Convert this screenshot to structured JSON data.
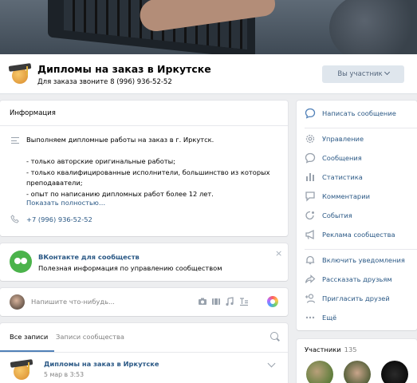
{
  "group": {
    "title": "Дипломы на заказ в Иркутске",
    "subtitle": "Для заказа звоните 8 (996) 936-52-52",
    "member_button": "Вы участник"
  },
  "info": {
    "header": "Информация",
    "description_lines": [
      "Выполняем дипломные работы на заказ в г. Иркутск.",
      "",
      "- только авторские оригинальные работы;",
      "- только квалифицированные исполнители, большинство из которых",
      "преподаватели;",
      "- опыт по написанию дипломных работ более 12 лет."
    ],
    "show_more": "Показать полностью…",
    "phone": "+7 (996) 936-52-52"
  },
  "promo": {
    "title": "ВКонтакте для сообществ",
    "text": "Полезная информация по управлению сообществом",
    "close": "×"
  },
  "composer": {
    "placeholder": "Напишите что-нибудь..."
  },
  "wall": {
    "tab_all": "Все записи",
    "tab_community": "Записи сообщества",
    "post_author": "Дипломы на заказ в Иркутске",
    "post_date": "5 мар в 3:53"
  },
  "menu": {
    "primary": "Написать сообщение",
    "items": [
      "Управление",
      "Сообщения",
      "Статистика",
      "Комментарии",
      "События",
      "Реклама сообщества"
    ],
    "items2": [
      "Включить уведомления",
      "Рассказать друзьям",
      "Пригласить друзей",
      "Ещё"
    ]
  },
  "members": {
    "label": "Участники",
    "count": "135"
  },
  "colors": {
    "link": "#2a5885",
    "accent": "#5181b8",
    "background": "#edeef0",
    "green": "#4bb34b"
  }
}
